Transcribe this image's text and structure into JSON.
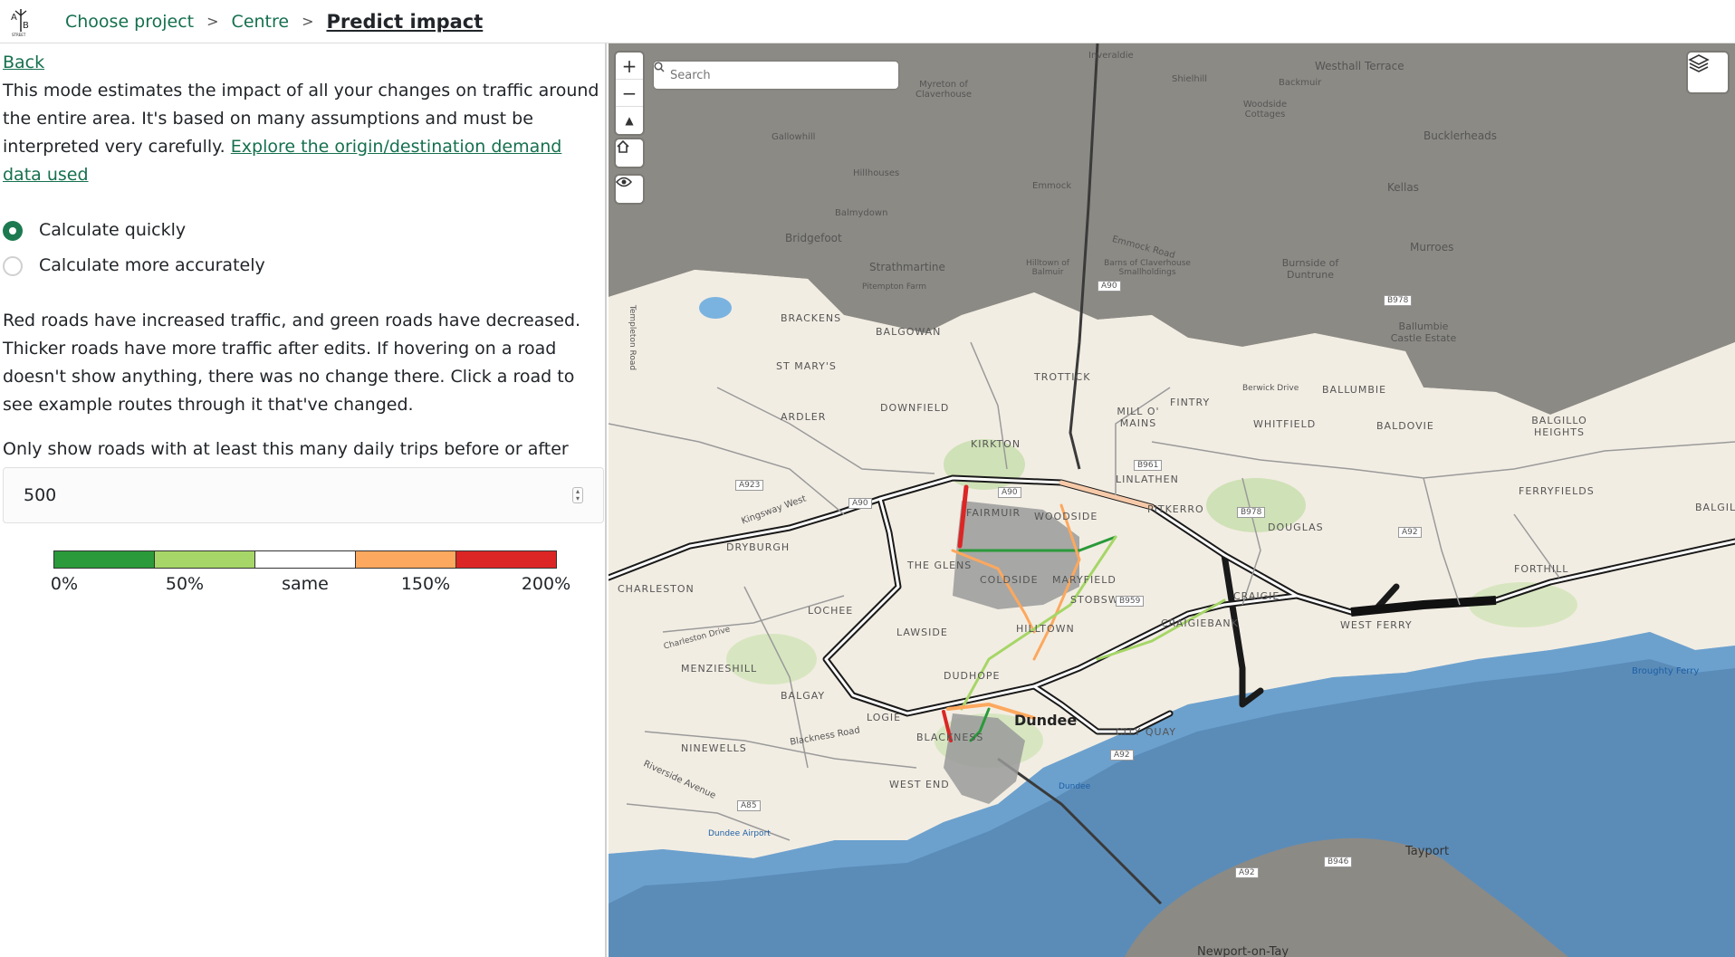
{
  "header": {
    "logo_text": "A/B STREET",
    "crumbs": [
      "Choose project",
      "Centre"
    ],
    "separator": ">",
    "current": "Predict impact"
  },
  "panel": {
    "back_label": "Back",
    "intro_text": "This mode estimates the impact of all your changes on traffic around the entire area. It's based on many assumptions and must be interpreted very carefully.",
    "intro_link": "Explore the origin/destination demand data used",
    "radio_quick": "Calculate quickly",
    "radio_accurate": "Calculate more accurately",
    "radio_selected": "quick",
    "explain_text": "Red roads have increased traffic, and green roads have decreased. Thicker roads have more traffic after edits. If hovering on a road doesn't show anything, there was no change there. Click a road to see example routes through it that've changed.",
    "threshold_label": "Only show roads with at least this many daily trips before or after",
    "threshold_value": "500",
    "legend": {
      "colors": [
        "#2a9a3a",
        "#a6d667",
        "#ffffff",
        "#fca85e",
        "#dc2626"
      ],
      "labels": [
        "0%",
        "50%",
        "same",
        "150%",
        "200%"
      ]
    }
  },
  "map": {
    "search_placeholder": "Search",
    "controls": {
      "zoom_in": "+",
      "zoom_out": "−"
    },
    "colors": {
      "water": "#5b8cb8",
      "hills": "#8c8a85",
      "land": "#efe9dc",
      "urban": "#f3eee5",
      "park": "#c8dfb0"
    },
    "labels": {
      "dundee": "Dundee",
      "tayport": "Tayport",
      "newport": "Newport-on-Tay",
      "inveraldie": "Inveraldie",
      "westhall": "Westhall Terrace",
      "shielhill": "Shielhill",
      "backmuir": "Backmuir",
      "myreton": "Myreton of Claverhouse",
      "woodside_c": "Woodside Cottages",
      "bucklerheads": "Bucklerheads",
      "gallowhill": "Gallowhill",
      "hillhouses": "Hillhouses",
      "emmock": "Emmock",
      "kellas": "Kellas",
      "balmydown": "Balmydown",
      "bridgefoot": "Bridgefoot",
      "emmock_road": "Emmock Road",
      "murroes": "Murroes",
      "strathmartine": "Strathmartine",
      "hilltown_balmuir": "Hilltown of Balmuir",
      "barns": "Barns of Claverhouse Smallholdings",
      "burnside": "Burnside of Duntrune",
      "pitempton": "Pitempton Farm",
      "brackens": "BRACKENS",
      "balgowan": "BALGOWAN",
      "ballumbie_ce": "Ballumbie Castle Estate",
      "st_marys": "ST MARY'S",
      "trottick": "TROTTICK",
      "berwick": "Berwick Drive",
      "ballumbie": "BALLUMBIE",
      "downfield": "DOWNFIELD",
      "ardler": "ARDLER",
      "mill_o_mains": "MILL O' MAINS",
      "fintry": "FINTRY",
      "whitfield": "WHITFIELD",
      "baldovie": "BALDOVIE",
      "balgillo": "BALGILLO HEIGHTS",
      "kirkton": "KIRKTON",
      "linlathen": "LINLATHEN",
      "ferryfields": "FERRYFIELDS",
      "fairmuir": "FAIRMUIR",
      "woodside": "WOODSIDE",
      "pitkerro": "PITKERRO",
      "balgil": "BALGIL",
      "dryburgh": "DRYBURGH",
      "douglas": "DOUGLAS",
      "kingsway": "Kingsway West",
      "the_glens": "THE GLENS",
      "coldside": "COLDSIDE",
      "maryfield": "MARYFIELD",
      "forthill": "FORTHILL",
      "charleston": "CHARLESTON",
      "stobswell": "STOBSWELL",
      "craigie": "CRAIGIE",
      "lochee": "LOCHEE",
      "craigiebank": "CRAIGIEBANK",
      "west_ferry": "WEST FERRY",
      "lawside": "LAWSIDE",
      "hilltown": "HILLTOWN",
      "charleston_dr": "Charleston Drive",
      "menzieshill": "MENZIESHILL",
      "broughty": "Broughty Ferry",
      "dudhope": "DUDHOPE",
      "balgay": "BALGAY",
      "logie": "LOGIE",
      "city_quay": "CITY QUAY",
      "blackness_rd": "Blackness Road",
      "blackness": "BLACKNESS",
      "ninewells": "NINEWELLS",
      "riverside": "Riverside Avenue",
      "west_end": "WEST END",
      "dundee_stn": "Dundee",
      "airport": "Dundee Airport",
      "templeton": "Templeton Road",
      "a90": "A90",
      "a923": "A923",
      "a90b": "A90",
      "b961": "B961",
      "b978": "B978",
      "b978b": "B978",
      "a92": "A92",
      "b959": "B959",
      "a92b": "A92",
      "a85": "A85",
      "a92c": "A92",
      "b946": "B946"
    }
  }
}
